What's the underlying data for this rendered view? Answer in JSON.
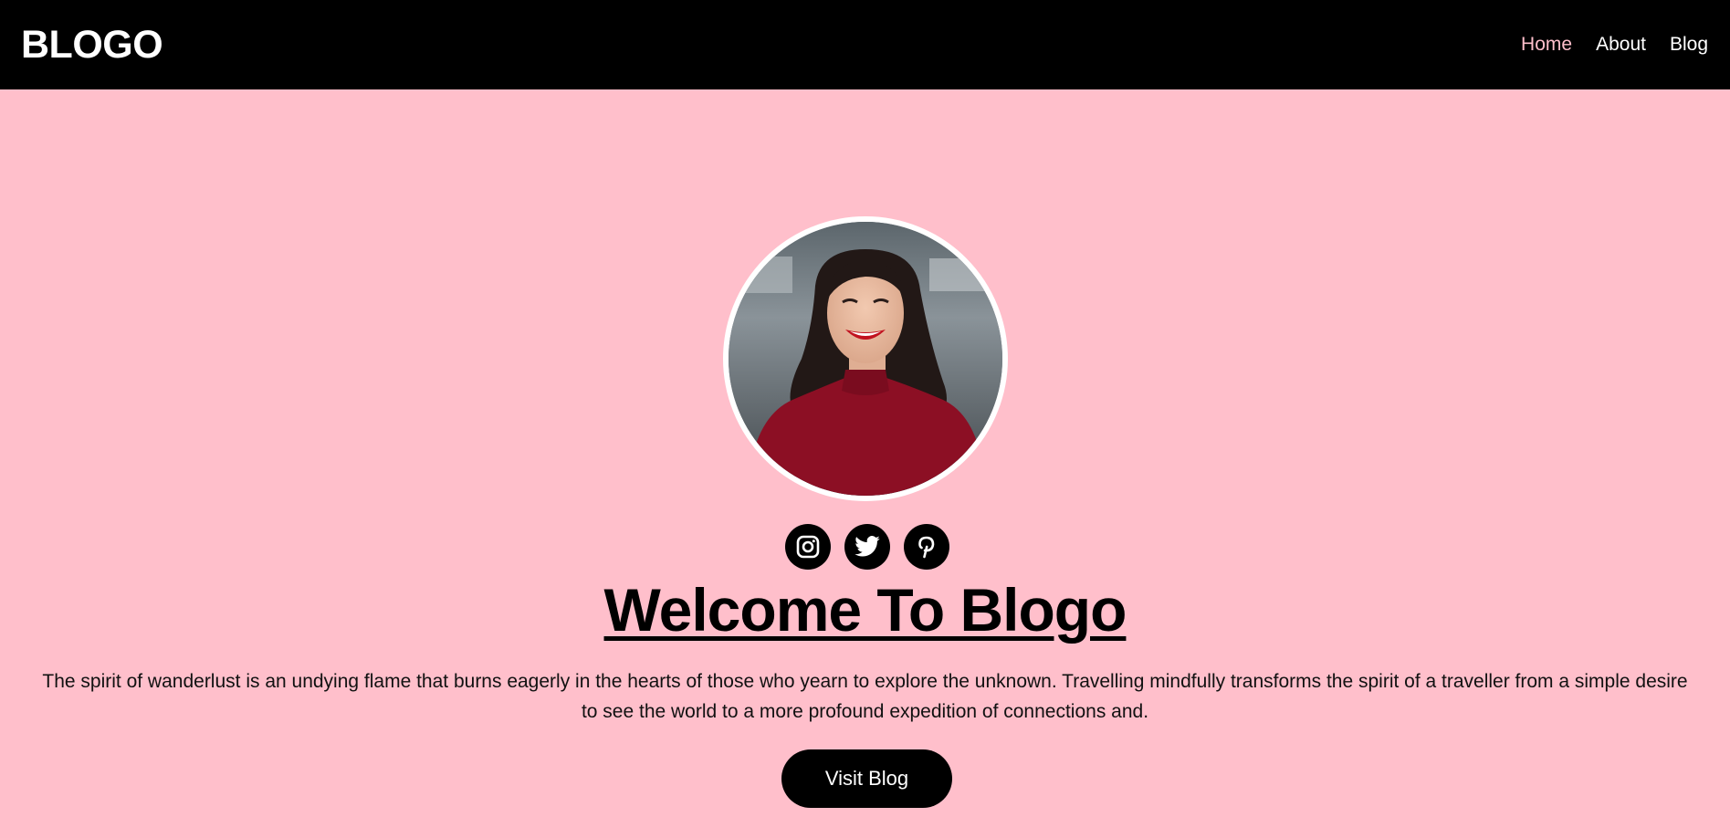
{
  "header": {
    "logo": "BLOGO",
    "nav": [
      {
        "label": "Home",
        "active": true
      },
      {
        "label": "About",
        "active": false
      },
      {
        "label": "Blog",
        "active": false
      }
    ],
    "background_color": "#000000",
    "active_color": "#ffbfcb"
  },
  "hero": {
    "avatar_icon": "profile-photo",
    "social_icons": [
      "instagram-icon",
      "twitter-icon",
      "pinterest-icon"
    ],
    "title": "Welcome To Blogo",
    "description": "The spirit of wanderlust is an undying flame that burns eagerly in the hearts of those who yearn to explore the unknown. Travelling mindfully transforms the spirit of a traveller from a simple desire to see the world to a more profound expedition of connections and.",
    "button_label": "Visit Blog",
    "background_color": "#ffbfcb"
  }
}
